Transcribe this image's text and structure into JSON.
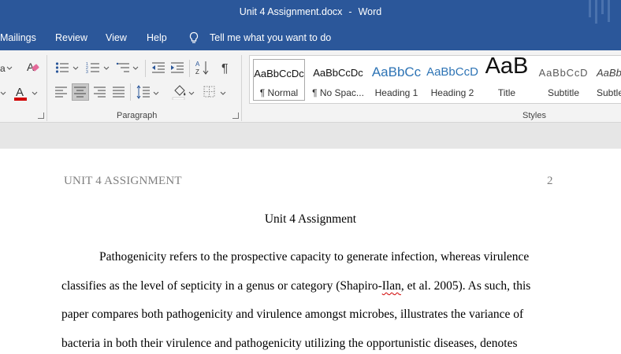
{
  "window": {
    "doc_name": "Unit 4 Assignment.docx",
    "separator": "-",
    "app_name": "Word"
  },
  "menu": {
    "items": [
      "Mailings",
      "Review",
      "View",
      "Help"
    ],
    "tell_me": "Tell me what you want to do"
  },
  "ribbon": {
    "paragraph_label": "Paragraph",
    "styles_label": "Styles",
    "styles": [
      {
        "preview": "AaBbCcDc",
        "name": "¶ Normal"
      },
      {
        "preview": "AaBbCcDc",
        "name": "¶ No Spac..."
      },
      {
        "preview": "AaBbCc",
        "name": "Heading 1"
      },
      {
        "preview": "AaBbCcD",
        "name": "Heading 2"
      },
      {
        "preview": "AaB",
        "name": "Title"
      },
      {
        "preview": "AaBbCcD",
        "name": "Subtitle"
      },
      {
        "preview": "AaBb",
        "name": "Subtle"
      }
    ]
  },
  "colors": {
    "title_bar": "#2b579a",
    "font_color_underline": "#d00000"
  },
  "document": {
    "running_head": "UNIT 4 ASSIGNMENT",
    "page_number": "2",
    "title": "Unit 4 Assignment",
    "line1": "Pathogenicity refers to the prospective capacity to generate infection, whereas virulence",
    "line2_a": "classifies as the level of septicity in a genus or category (Shapiro-",
    "line2_flagged": "Ilan",
    "line2_b": ", et al. 2005). As such, this",
    "line3": "paper compares both pathogenicity and virulence amongst microbes, illustrates the variance of",
    "line4": "bacteria in both their virulence and pathogenicity utilizing the opportunistic diseases, denotes"
  }
}
